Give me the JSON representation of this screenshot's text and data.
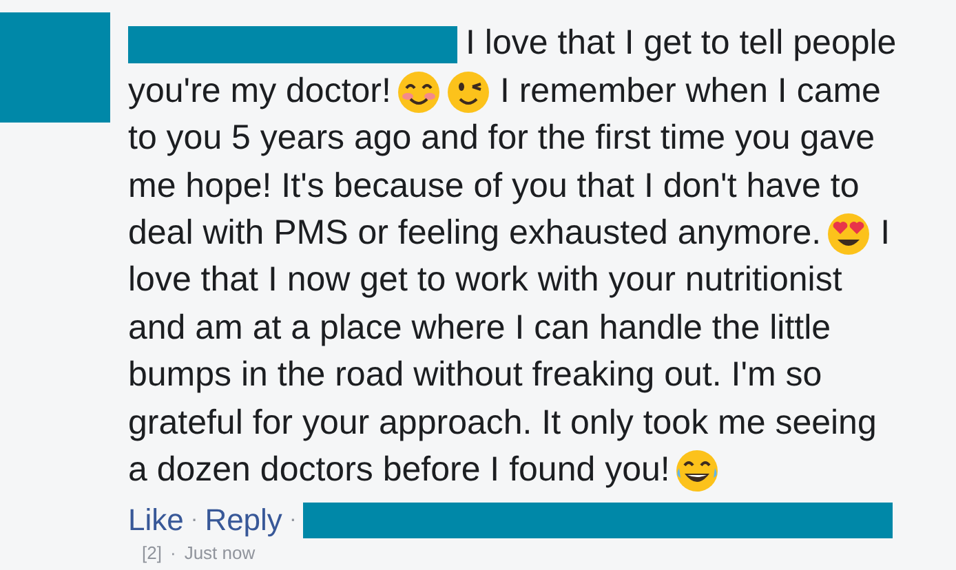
{
  "comment": {
    "lines": [
      [
        {
          "kind": "text",
          "text": "I love that I get to tell people"
        }
      ],
      [
        {
          "kind": "text",
          "text": "you're my doctor!"
        },
        {
          "kind": "blush"
        },
        {
          "kind": "wink"
        },
        {
          "kind": "text",
          "text": "I remember when I came"
        }
      ],
      [
        {
          "kind": "text",
          "text": "to you 5 years ago and for the first time you gave"
        }
      ],
      [
        {
          "kind": "text",
          "text": "me hope! It's because of you that I don't have to"
        }
      ],
      [
        {
          "kind": "text",
          "text": "deal with PMS or feeling exhausted anymore."
        },
        {
          "kind": "heart-eyes"
        },
        {
          "kind": "text",
          "text": "I"
        }
      ],
      [
        {
          "kind": "text",
          "text": "love that I now get to work with your nutritionist"
        }
      ],
      [
        {
          "kind": "text",
          "text": "and am at a place where I can handle the little"
        }
      ],
      [
        {
          "kind": "text",
          "text": "bumps in the road without freaking out. I'm so"
        }
      ],
      [
        {
          "kind": "text",
          "text": "grateful for your approach. It only took me seeing"
        }
      ],
      [
        {
          "kind": "text",
          "text": "a dozen doctors before I found you!"
        },
        {
          "kind": "joy"
        }
      ]
    ],
    "actions": [
      {
        "label": "Like"
      },
      {
        "label": "Reply"
      }
    ],
    "separator": "·",
    "reaction_count": "[2]",
    "time": "Just now"
  }
}
